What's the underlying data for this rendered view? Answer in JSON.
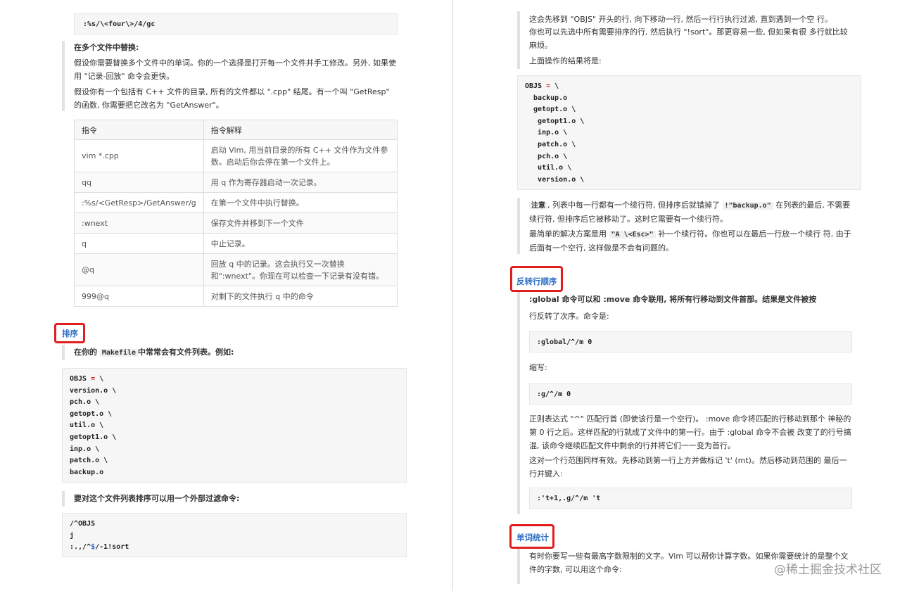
{
  "left": {
    "top_code": ":%s/\\<four\\>/4/gc",
    "multi_file_heading": "在多个文件中替换:",
    "para1": "假设你需要替换多个文件中的单词。你的一个选择是打开每一个文件并手工修改。另外, 如果使用 \"记录-回放\" 命令会更快。",
    "para2": "假设你有一个包括有 C++ 文件的目录, 所有的文件都以 \".cpp\" 结尾。有一个叫 \"GetResp\" 的函数, 你需要把它改名为 \"GetAnswer\"。",
    "table": {
      "headers": [
        "指令",
        "指令解释"
      ],
      "rows": [
        [
          "vim *.cpp",
          "启动 Vim, 用当前目录的所有 C++ 文件作为文件参数。启动后你会停在第一个文件上。"
        ],
        [
          "qq",
          "用 q 作为寄存器启动一次记录。"
        ],
        [
          ":%s/<GetResp>/GetAnswer/g",
          "在第一个文件中执行替换。"
        ],
        [
          ":wnext",
          "保存文件并移到下一个文件"
        ],
        [
          "q",
          "中止记录。"
        ],
        [
          "@q",
          "回放 q 中的记录。这会执行又一次替换和\":wnext\"。你现在可以检查一下记录有没有错。"
        ],
        [
          "999@q",
          "对剩下的文件执行 q 中的命令"
        ]
      ]
    },
    "sort_heading": "排序",
    "makefile_pre": "在你的",
    "makefile_code": "Makefile",
    "makefile_post": "中常常会有文件列表。例如:",
    "objs_code": [
      "OBJS = \\",
      "version.o \\",
      "pch.o \\",
      "getopt.o \\",
      "util.o \\",
      "getopt1.o \\",
      "inp.o \\",
      "patch.o \\",
      "backup.o"
    ],
    "filter_text": "要对这个文件列表排序可以用一个外部过滤命令:",
    "filter_code": [
      "/^OBJS",
      "j",
      ":.,/^$/-1!sort"
    ]
  },
  "right": {
    "para_top1": "这会先移到 \"OBJS\" 开头的行, 向下移动一行, 然后一行行执行过滤, 直到遇到一个空 行。",
    "para_top2": "你也可以先选中所有需要排序的行, 然后执行 \"!sort\"。那更容易一些, 但如果有很 多行就比较麻烦。",
    "result_text": "上面操作的结果将是:",
    "result_code": [
      "OBJS = \\",
      "  backup.o",
      "  getopt.o \\",
      "   getopt1.o \\",
      "   inp.o \\",
      "   patch.o \\",
      "   pch.o \\",
      "   util.o \\",
      "   version.o \\"
    ],
    "note_prefix": "注意",
    "note_mid": ", 列表中每一行都有一个续行符, 但排序后就错掉了",
    "note_code": "!\"backup.o\"",
    "note_post": "在列表的最后, 不需要续行符, 但排序后它被移动了。这时它需要有一个续行符。",
    "simple_pre": "最简单的解决方案是用",
    "simple_code": "\"A \\<Esc>\"",
    "simple_post": "补一个续行符。你也可以在最后一行放一个续行 符, 由于后面有一个空行, 这样做是不会有问题的。",
    "reverse_heading": "反转行顺序",
    "reverse_text1": ":global 命令可以和 :move 命令联用, 将所有行移动到文件首部。结果是文件被按",
    "reverse_text2": "行反转了次序。命令是:",
    "global_code": ":global/^/m 0",
    "abbr_text": "缩写:",
    "g_code": ":g/^/m 0",
    "regex_text": "正则表达式 \"^\" 匹配行首 (即使该行是一个空行)。 :move 命令将匹配的行移动到那个 神秘的第 0 行之后。这样匹配的行就成了文件中的第一行。由于 :global 命令不会被 改变了的行号搞混, 该命令继续匹配文件中剩余的行并将它们一一变为首行。",
    "range_text": "这对一个行范围同样有效。先移动到第一行上方并做标记 't' (mt)。然后移动到范围的 最后一行并键入:",
    "range_code": ":'t+1,.g/^/m 't",
    "wordcount_heading": "单词统计",
    "wordcount_text": "有时你要写一些有最高字数限制的文字。Vim 可以帮你计算字数。如果你需要统计的是整个文件的字数, 可以用这个命令:"
  },
  "watermark": "@稀土掘金技术社区",
  "colors": {
    "heading": "#2d6fc4",
    "highlight_box": "#e21d1d",
    "code_bg": "#f6f6f6"
  }
}
